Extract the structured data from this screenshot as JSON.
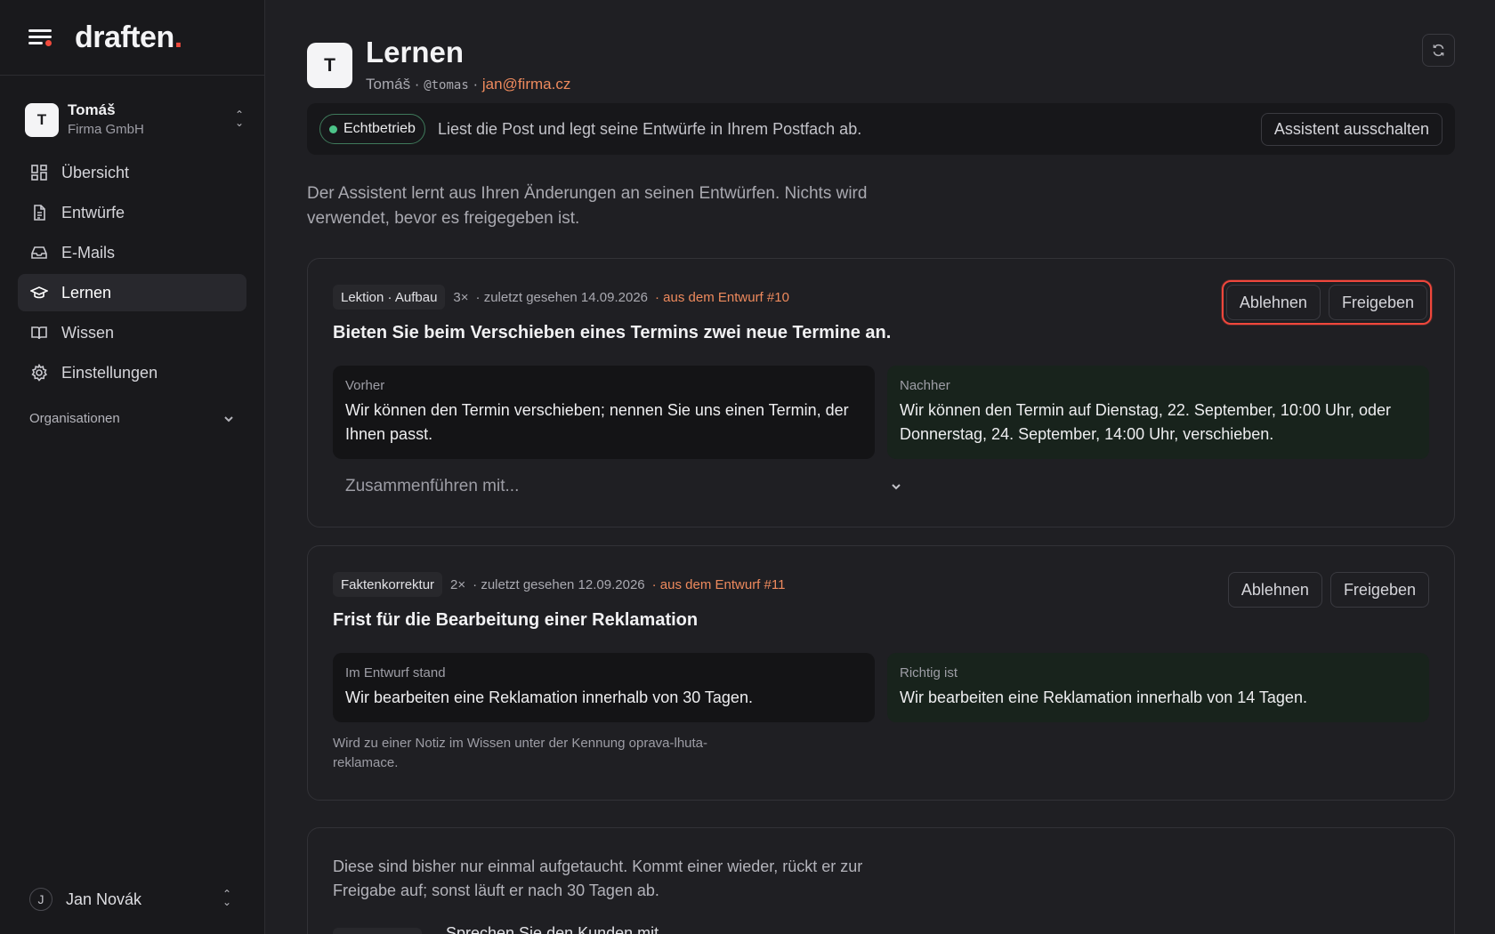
{
  "app": {
    "logo": "draften",
    "logo_dot": "."
  },
  "org": {
    "avatar": "T",
    "name": "Tomáš",
    "company": "Firma GmbH"
  },
  "nav": {
    "items": [
      {
        "label": "Übersicht",
        "icon": "grid-icon"
      },
      {
        "label": "Entwürfe",
        "icon": "document-icon"
      },
      {
        "label": "E-Mails",
        "icon": "inbox-icon"
      },
      {
        "label": "Lernen",
        "icon": "graduation-cap-icon",
        "active": true
      },
      {
        "label": "Wissen",
        "icon": "book-icon"
      },
      {
        "label": "Einstellungen",
        "icon": "gear-icon"
      }
    ],
    "organizations_label": "Organisationen"
  },
  "user": {
    "avatar": "J",
    "name": "Jan Novák"
  },
  "header": {
    "avatar": "T",
    "title": "Lernen",
    "name": "Tomáš",
    "sep1": " · ",
    "handle": "@tomas",
    "sep2": " · ",
    "email": "jan@firma.cz"
  },
  "status": {
    "badge": "Echtbetrieb",
    "text": "Liest die Post und legt seine Entwürfe in Ihrem Postfach ab.",
    "toggle_button": "Assistent ausschalten"
  },
  "intro": "Der Assistent lernt aus Ihren Änderungen an seinen Entwürfen. Nichts wird verwendet, bevor es freigegeben ist.",
  "lessons": [
    {
      "tag": "Lektion · Aufbau",
      "count": "3×",
      "seen": "· zuletzt gesehen 14.09.2026",
      "source": "· aus dem Entwurf #10",
      "reject": "Ablehnen",
      "approve": "Freigeben",
      "title": "Bieten Sie beim Verschieben eines Termins zwei neue Termine an.",
      "before_label": "Vorher",
      "before_text": "Wir können den Termin verschieben; nennen Sie uns einen Termin, der Ihnen passt.",
      "after_label": "Nachher",
      "after_text": "Wir können den Termin auf Dienstag, 22. September, 10:00 Uhr, oder Donnerstag, 24. September, 14:00 Uhr, verschieben.",
      "merge_placeholder": "Zusammenführen mit..."
    },
    {
      "tag": "Faktenkorrektur",
      "count": "2×",
      "seen": "· zuletzt gesehen 12.09.2026",
      "source": "· aus dem Entwurf #11",
      "reject": "Ablehnen",
      "approve": "Freigeben",
      "title": "Frist für die Bearbeitung einer Reklamation",
      "before_label": "Im Entwurf stand",
      "before_text": "Wir bearbeiten eine Reklamation innerhalb von 30 Tagen.",
      "after_label": "Richtig ist",
      "after_text": "Wir bearbeiten eine Reklamation innerhalb von 14 Tagen.",
      "note": "Wird zu einer Notiz im Wissen unter der Kennung oprava-lhuta-reklamace."
    }
  ],
  "pending": {
    "text": "Diese sind bisher nur einmal aufgetaucht. Kommt einer wieder, rückt er zur Freigabe auf; sonst läuft er nach 30 Tagen ab.",
    "peek": "Sprechen Sie den Kunden mit"
  },
  "colors": {
    "accent": "#ee8a5d",
    "brand_dot": "#ef4a3c",
    "live_green": "#4cc489",
    "highlight": "#f0473c"
  }
}
